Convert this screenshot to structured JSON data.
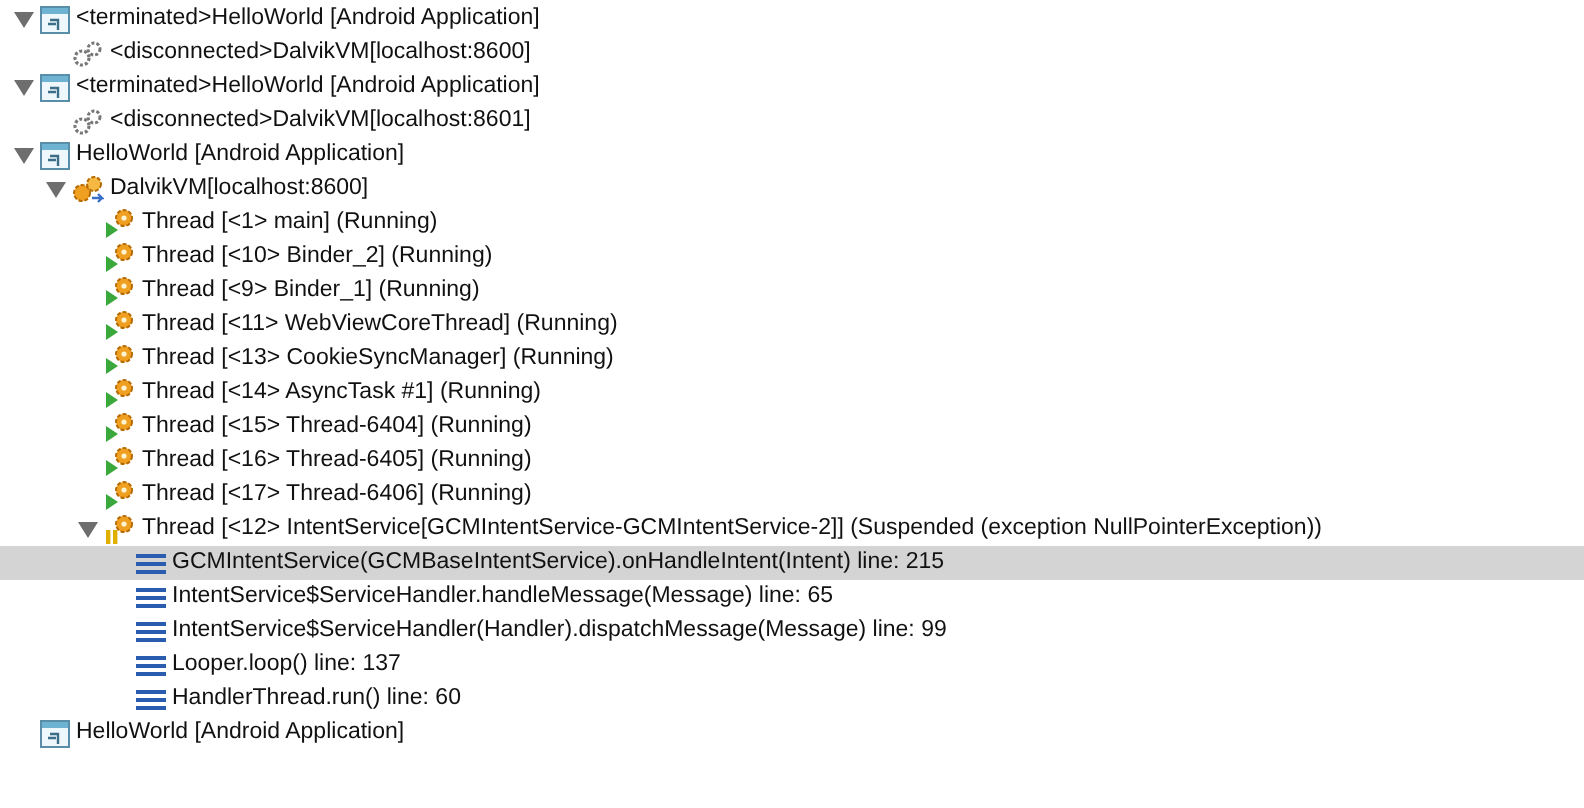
{
  "debug_tree": [
    {
      "kind": "launch",
      "label": "<terminated>HelloWorld [Android Application]",
      "expanded": true,
      "children": [
        {
          "kind": "target",
          "label": "<disconnected>DalvikVM[localhost:8600]"
        }
      ]
    },
    {
      "kind": "launch",
      "label": "<terminated>HelloWorld [Android Application]",
      "expanded": true,
      "children": [
        {
          "kind": "target",
          "label": "<disconnected>DalvikVM[localhost:8601]"
        }
      ]
    },
    {
      "kind": "launch",
      "label": "HelloWorld [Android Application]",
      "expanded": true,
      "children": [
        {
          "kind": "vm",
          "label": "DalvikVM[localhost:8600]",
          "expanded": true,
          "children": [
            {
              "kind": "thread",
              "label": "Thread [<1> main] (Running)",
              "suspended": false
            },
            {
              "kind": "thread",
              "label": "Thread [<10> Binder_2] (Running)",
              "suspended": false
            },
            {
              "kind": "thread",
              "label": "Thread [<9> Binder_1] (Running)",
              "suspended": false
            },
            {
              "kind": "thread",
              "label": "Thread [<11> WebViewCoreThread] (Running)",
              "suspended": false
            },
            {
              "kind": "thread",
              "label": "Thread [<13> CookieSyncManager] (Running)",
              "suspended": false
            },
            {
              "kind": "thread",
              "label": "Thread [<14> AsyncTask #1] (Running)",
              "suspended": false
            },
            {
              "kind": "thread",
              "label": "Thread [<15> Thread-6404] (Running)",
              "suspended": false
            },
            {
              "kind": "thread",
              "label": "Thread [<16> Thread-6405] (Running)",
              "suspended": false
            },
            {
              "kind": "thread",
              "label": "Thread [<17> Thread-6406] (Running)",
              "suspended": false
            },
            {
              "kind": "thread",
              "label": "Thread [<12> IntentService[GCMIntentService-GCMIntentService-2]] (Suspended (exception NullPointerException))",
              "suspended": true,
              "expanded": true,
              "children": [
                {
                  "kind": "frame",
                  "label": "GCMIntentService(GCMBaseIntentService).onHandleIntent(Intent) line: 215",
                  "selected": true
                },
                {
                  "kind": "frame",
                  "label": "IntentService$ServiceHandler.handleMessage(Message) line: 65",
                  "selected": false
                },
                {
                  "kind": "frame",
                  "label": "IntentService$ServiceHandler(Handler).dispatchMessage(Message) line: 99",
                  "selected": false
                },
                {
                  "kind": "frame",
                  "label": "Looper.loop() line: 137",
                  "selected": false
                },
                {
                  "kind": "frame",
                  "label": "HandlerThread.run() line: 60",
                  "selected": false
                }
              ]
            }
          ]
        }
      ]
    },
    {
      "kind": "launch",
      "label": "HelloWorld [Android Application]"
    }
  ]
}
